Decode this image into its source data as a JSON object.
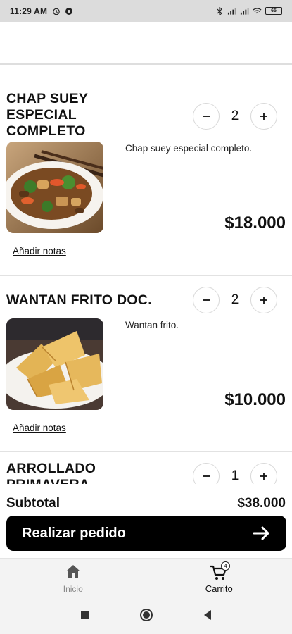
{
  "status_bar": {
    "time": "11:29 AM",
    "battery": "65",
    "icons": [
      "alarm-icon",
      "app-notification-icon",
      "bluetooth-icon",
      "signal-icon",
      "signal-icon",
      "wifi-icon",
      "battery-icon"
    ]
  },
  "cart_items": [
    {
      "title_lines": [
        "CHAP SUEY",
        "ESPECIAL",
        "COMPLETO"
      ],
      "quantity": "2",
      "description": "Chap suey especial completo.",
      "price": "$18.000",
      "notes_link": "Añadir notas",
      "image": "stir-fry-dish-image"
    },
    {
      "title_lines": [
        "WANTAN FRITO DOC."
      ],
      "quantity": "2",
      "description": "Wantan frito.",
      "price": "$10.000",
      "notes_link": "Añadir notas",
      "image": "fried-wonton-image"
    },
    {
      "title_lines": [
        "ARROLLADO",
        "PRIMAVERA"
      ],
      "quantity": "1",
      "image": "spring-roll-image"
    }
  ],
  "summary": {
    "subtotal_label": "Subtotal",
    "subtotal_value": "$38.000",
    "order_button": "Realizar pedido"
  },
  "tabbar": {
    "home_label": "Inicio",
    "cart_label": "Carrito",
    "cart_badge": "4"
  },
  "colors": {
    "primary_button": "#000000",
    "status_bar_bg": "#dcdcdc",
    "inactive_tab": "#8a8a8a"
  }
}
